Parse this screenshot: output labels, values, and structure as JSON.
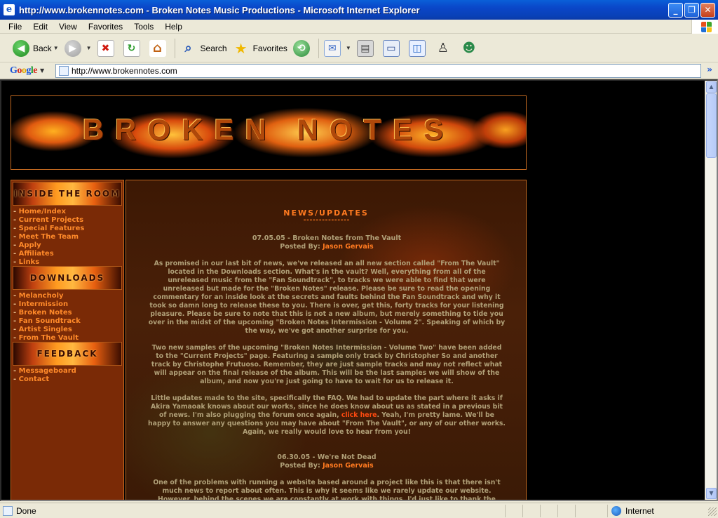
{
  "window": {
    "title": "http://www.brokennotes.com - Broken Notes Music Productions - Microsoft Internet Explorer",
    "minimize": "_",
    "restore": "❐",
    "close": "✕"
  },
  "menu": [
    "File",
    "Edit",
    "View",
    "Favorites",
    "Tools",
    "Help"
  ],
  "toolbar": {
    "back": "Back",
    "search": "Search",
    "favorites": "Favorites"
  },
  "addressbar": {
    "google_label": [
      "G",
      "o",
      "o",
      "g",
      "l",
      "e"
    ],
    "url": "http://www.brokennotes.com",
    "go": "»"
  },
  "page": {
    "banner_title": "BROKEN NOTES",
    "sections": [
      {
        "header": "INSIDE THE ROOM",
        "items": [
          "Home/Index",
          "Current Projects",
          "Special Features",
          "Meet The Team",
          "Apply",
          "Affiliates",
          "Links"
        ]
      },
      {
        "header": "DOWNLOADS",
        "items": [
          "Melancholy",
          "Intermission",
          "Broken Notes",
          "Fan Soundtrack",
          "Artist Singles",
          "From The Vault"
        ]
      },
      {
        "header": "FEEDBACK",
        "items": [
          "Messageboard",
          "Contact"
        ]
      }
    ],
    "news_title": "NEWS/UPDATES",
    "news_underline": "---------------",
    "posts": [
      {
        "heading": "07.05.05 - Broken Notes from The Vault",
        "posted_by_label": "Posted By: ",
        "author": "Jason Gervais",
        "p1": "As promised in our last bit of news, we've released an all new section called \"From The Vault\" located in the Downloads section. What's in the vault? Well, everything from all of the unreleased music from the \"Fan Soundtrack\", to tracks we were able to find that were unreleased but made for the \"Broken Notes\" release. Please be sure to read the opening commentary for an inside look at the secrets and faults behind the Fan Soundtrack and why it took so damn long to release these to you. There is over, get this, forty tracks for your listening pleasure. Please be sure to note that this is not a new album, but merely something to tide you over in the midst of the upcoming \"Broken Notes Intermission - Volume 2\". Speaking of which by the way, we've got another surprise for you.",
        "p2": "Two new samples of the upcoming \"Broken Notes Intermission - Volume Two\" have been added to the \"Current Projects\" page. Featuring a sample only track by Christopher So and another track by Christophe Frutuoso. Remember, they are just sample tracks and may not reflect what will appear on the final release of the album. This will be the last samples we will show of the album, and now you're just going to have to wait for us to release it.",
        "p3_before": "Little updates made to the site, specifically the FAQ. We had to update the part where it asks if Akira Yamaoak knows about our works, since he does know about us as stated in a previous bit of news. I'm also plugging the forum once again, ",
        "p3_link": "click here",
        "p3_after": ". Yeah, I'm pretty lame. We'll be happy to answer any questions you may have about \"From The Vault\", or any of our other works. Again, we really would love to hear from you!"
      },
      {
        "heading": "06.30.05 - We're Not Dead",
        "posted_by_label": "Posted By: ",
        "author": "Jason Gervais",
        "p1": "One of the problems with running a website based around a project like this is that there isn't much news to report about often. This is why it seems like we rarely update our website. However, behind the scenes we are constantly at work with things. I'd just like to thank the"
      }
    ]
  },
  "status": {
    "text": "Done",
    "zone": "Internet"
  },
  "colors": {
    "accent_orange": "#ff7a20",
    "link_red": "#ff4a10",
    "body_text": "#b0a078",
    "xp_blue": "#0a46c8"
  }
}
